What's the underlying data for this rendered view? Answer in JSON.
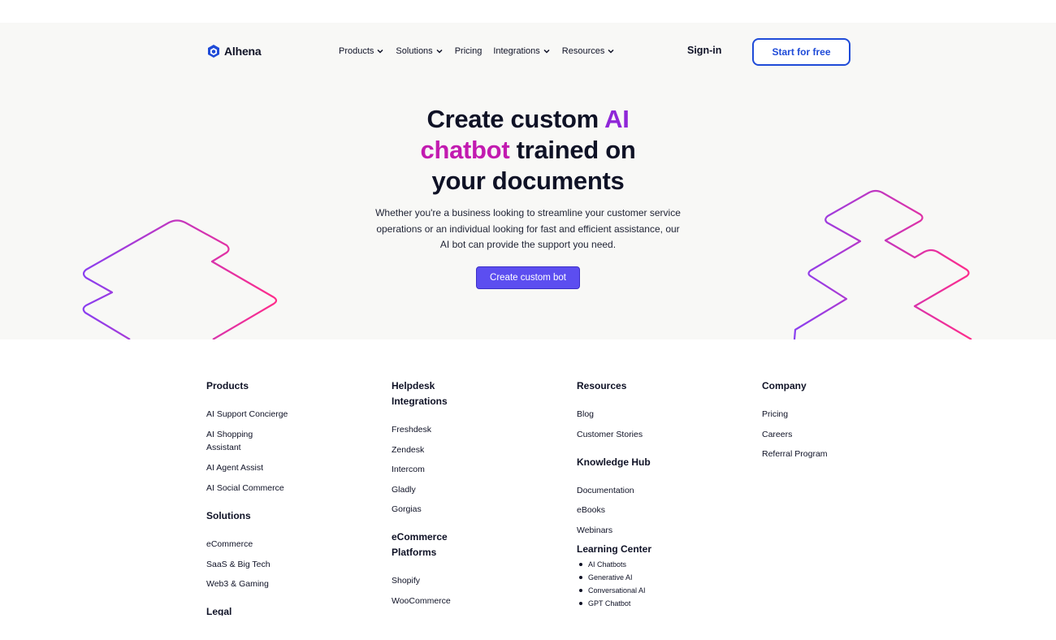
{
  "brand": {
    "name": "Alhena",
    "icon": "hexagon-logo-icon",
    "accent": "#1f4bd8"
  },
  "nav": {
    "items": [
      {
        "label": "Products",
        "has_dropdown": true
      },
      {
        "label": "Solutions",
        "has_dropdown": true
      },
      {
        "label": "Pricing",
        "has_dropdown": false
      },
      {
        "label": "Integrations",
        "has_dropdown": true
      },
      {
        "label": "Resources",
        "has_dropdown": true
      }
    ],
    "signin": "Sign-in",
    "cta": "Start for free"
  },
  "hero": {
    "headline_1": "Create custom ",
    "headline_ai": "AI",
    "headline_chatbot": "chatbot",
    "headline_2": " trained on",
    "headline_3": "your documents",
    "subtitle": "Whether you're a business looking to streamline your customer service operations or an individual looking for fast and efficient assistance, our AI bot can provide the support you need.",
    "cta": "Create custom bot",
    "colors": {
      "ai": "#8f27d8",
      "chatbot": "#c21bb0",
      "button": "#5c4ef0"
    }
  },
  "footer": {
    "products": {
      "heading": "Products",
      "links": [
        "AI Support Concierge",
        "AI Shopping",
        "Assistant",
        "AI Agent Assist",
        "AI Social Commerce"
      ]
    },
    "solutions": {
      "heading": "Solutions",
      "links": [
        "eCommerce",
        "SaaS & Big Tech",
        "Web3 & Gaming"
      ]
    },
    "legal": {
      "heading": "Legal"
    },
    "helpdesk": {
      "heading_1": "Helpdesk",
      "heading_2": "Integrations",
      "links": [
        "Freshdesk",
        "Zendesk",
        "Intercom",
        "Gladly",
        "Gorgias"
      ]
    },
    "ecommerce": {
      "heading_1": "eCommerce",
      "heading_2": "Platforms",
      "links": [
        "Shopify",
        "WooCommerce"
      ]
    },
    "resources": {
      "heading": "Resources",
      "links": [
        "Blog",
        "Customer Stories"
      ]
    },
    "knowledge": {
      "heading": "Knowledge Hub",
      "links": [
        "Documentation",
        "eBooks",
        "Webinars"
      ]
    },
    "learning": {
      "heading": "Learning Center",
      "links": [
        "AI Chatbots",
        "Generative AI",
        "Conversational AI",
        "GPT Chatbot"
      ]
    },
    "company": {
      "heading": "Company",
      "links": [
        "Pricing",
        "Careers",
        "Referral Program"
      ]
    }
  }
}
